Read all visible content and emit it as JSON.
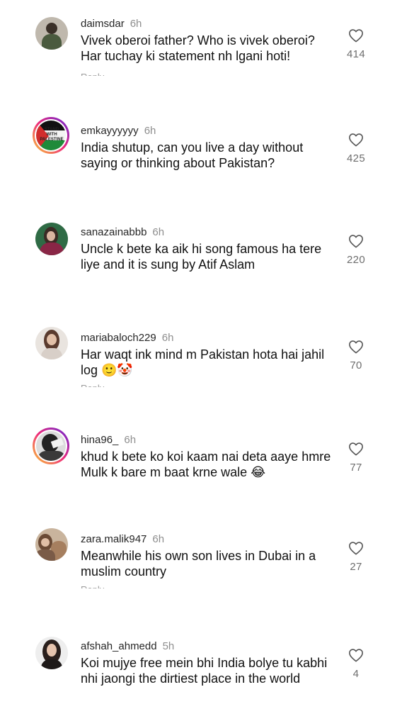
{
  "comments": [
    {
      "username": "daimsdar",
      "time": "6h",
      "text": "Vivek oberoi father? Who is vivek oberoi? Har tuchay ki statement nh lgani hoti!",
      "likes": "414",
      "reply": "Reply"
    },
    {
      "username": "emkayyyyyy",
      "time": "6h",
      "text": "India shutup, can you live a day without saying or thinking about Pakistan?",
      "likes": "425",
      "avatar_text": "STAND WITH PALESTINE"
    },
    {
      "username": "sanazainabbb",
      "time": "6h",
      "text": "Uncle k bete ka aik hi song famous ha tere liye and it is sung by Atif Aslam",
      "likes": "220"
    },
    {
      "username": "mariabaloch229",
      "time": "6h",
      "text": "Har waqt ink mind m Pakistan hota hai jahil log 🙂🤡",
      "likes": "70",
      "reply": "Reply"
    },
    {
      "username": "hina96_",
      "time": "6h",
      "text": "khud k bete ko koi kaam nai deta aaye hmre Mulk k bare m baat krne wale 😂",
      "likes": "77"
    },
    {
      "username": "zara.malik947",
      "time": "6h",
      "text": "Meanwhile his own son lives in Dubai in a muslim country",
      "likes": "27",
      "reply": "Reply"
    },
    {
      "username": "afshah_ahmedd",
      "time": "5h",
      "text": "Koi mujye free mein bhi India bolye tu kabhi nhi jaongi the dirtiest place in the world",
      "likes": "4"
    }
  ],
  "icons": {
    "like": "heart-outline-icon"
  },
  "colors": {
    "text": "#111111",
    "username": "#262626",
    "muted": "#8e8e8e",
    "count": "#6e6e6e"
  }
}
